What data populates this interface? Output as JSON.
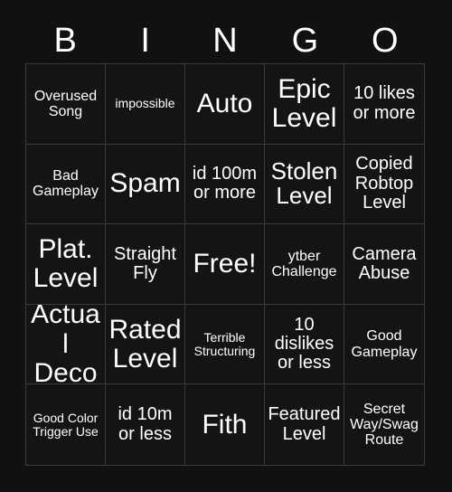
{
  "title": "BINGO",
  "header": {
    "letters": [
      "B",
      "I",
      "N",
      "G",
      "O"
    ]
  },
  "colors": {
    "background": "#111111",
    "cell_background": "#141414",
    "grid_line": "#3a3a3a",
    "text": "#ffffff"
  },
  "grid": {
    "columns": 5,
    "rows": 5,
    "cells": [
      {
        "text": "Overused Song",
        "size": "sm"
      },
      {
        "text": "impossible",
        "size": "xs"
      },
      {
        "text": "Auto",
        "size": "xl"
      },
      {
        "text": "Epic Level",
        "size": "xl"
      },
      {
        "text": "10 likes or more",
        "size": "md"
      },
      {
        "text": "Bad Gameplay",
        "size": "sm"
      },
      {
        "text": "Spam",
        "size": "xl"
      },
      {
        "text": "id 100m or more",
        "size": "md"
      },
      {
        "text": "Stolen Level",
        "size": "lg"
      },
      {
        "text": "Copied Robtop Level",
        "size": "md"
      },
      {
        "text": "Plat. Level",
        "size": "xl"
      },
      {
        "text": "Straight Fly",
        "size": "md"
      },
      {
        "text": "Free!",
        "size": "xl"
      },
      {
        "text": "ytber Challenge",
        "size": "sm"
      },
      {
        "text": "Camera Abuse",
        "size": "md"
      },
      {
        "text": "Actual Deco",
        "size": "xl"
      },
      {
        "text": "Rated Level",
        "size": "xl"
      },
      {
        "text": "Terrible Structuring",
        "size": "xs"
      },
      {
        "text": "10 dislikes or less",
        "size": "md"
      },
      {
        "text": "Good Gameplay",
        "size": "sm"
      },
      {
        "text": "Good Color Trigger Use",
        "size": "xs"
      },
      {
        "text": "id 10m or less",
        "size": "md"
      },
      {
        "text": "Fith",
        "size": "xl"
      },
      {
        "text": "Featured Level",
        "size": "md"
      },
      {
        "text": "Secret Way/Swag Route",
        "size": "sm"
      }
    ]
  }
}
